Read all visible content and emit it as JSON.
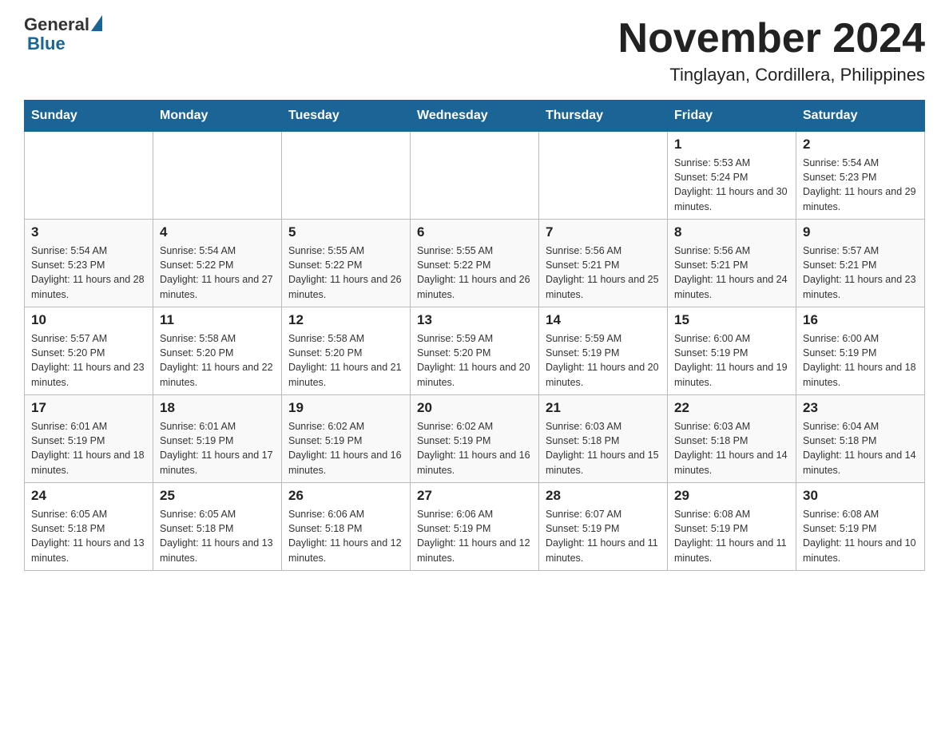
{
  "logo": {
    "general": "General",
    "blue": "Blue"
  },
  "title": "November 2024",
  "subtitle": "Tinglayan, Cordillera, Philippines",
  "days_of_week": [
    "Sunday",
    "Monday",
    "Tuesday",
    "Wednesday",
    "Thursday",
    "Friday",
    "Saturday"
  ],
  "weeks": [
    [
      {
        "day": "",
        "info": ""
      },
      {
        "day": "",
        "info": ""
      },
      {
        "day": "",
        "info": ""
      },
      {
        "day": "",
        "info": ""
      },
      {
        "day": "",
        "info": ""
      },
      {
        "day": "1",
        "info": "Sunrise: 5:53 AM\nSunset: 5:24 PM\nDaylight: 11 hours and 30 minutes."
      },
      {
        "day": "2",
        "info": "Sunrise: 5:54 AM\nSunset: 5:23 PM\nDaylight: 11 hours and 29 minutes."
      }
    ],
    [
      {
        "day": "3",
        "info": "Sunrise: 5:54 AM\nSunset: 5:23 PM\nDaylight: 11 hours and 28 minutes."
      },
      {
        "day": "4",
        "info": "Sunrise: 5:54 AM\nSunset: 5:22 PM\nDaylight: 11 hours and 27 minutes."
      },
      {
        "day": "5",
        "info": "Sunrise: 5:55 AM\nSunset: 5:22 PM\nDaylight: 11 hours and 26 minutes."
      },
      {
        "day": "6",
        "info": "Sunrise: 5:55 AM\nSunset: 5:22 PM\nDaylight: 11 hours and 26 minutes."
      },
      {
        "day": "7",
        "info": "Sunrise: 5:56 AM\nSunset: 5:21 PM\nDaylight: 11 hours and 25 minutes."
      },
      {
        "day": "8",
        "info": "Sunrise: 5:56 AM\nSunset: 5:21 PM\nDaylight: 11 hours and 24 minutes."
      },
      {
        "day": "9",
        "info": "Sunrise: 5:57 AM\nSunset: 5:21 PM\nDaylight: 11 hours and 23 minutes."
      }
    ],
    [
      {
        "day": "10",
        "info": "Sunrise: 5:57 AM\nSunset: 5:20 PM\nDaylight: 11 hours and 23 minutes."
      },
      {
        "day": "11",
        "info": "Sunrise: 5:58 AM\nSunset: 5:20 PM\nDaylight: 11 hours and 22 minutes."
      },
      {
        "day": "12",
        "info": "Sunrise: 5:58 AM\nSunset: 5:20 PM\nDaylight: 11 hours and 21 minutes."
      },
      {
        "day": "13",
        "info": "Sunrise: 5:59 AM\nSunset: 5:20 PM\nDaylight: 11 hours and 20 minutes."
      },
      {
        "day": "14",
        "info": "Sunrise: 5:59 AM\nSunset: 5:19 PM\nDaylight: 11 hours and 20 minutes."
      },
      {
        "day": "15",
        "info": "Sunrise: 6:00 AM\nSunset: 5:19 PM\nDaylight: 11 hours and 19 minutes."
      },
      {
        "day": "16",
        "info": "Sunrise: 6:00 AM\nSunset: 5:19 PM\nDaylight: 11 hours and 18 minutes."
      }
    ],
    [
      {
        "day": "17",
        "info": "Sunrise: 6:01 AM\nSunset: 5:19 PM\nDaylight: 11 hours and 18 minutes."
      },
      {
        "day": "18",
        "info": "Sunrise: 6:01 AM\nSunset: 5:19 PM\nDaylight: 11 hours and 17 minutes."
      },
      {
        "day": "19",
        "info": "Sunrise: 6:02 AM\nSunset: 5:19 PM\nDaylight: 11 hours and 16 minutes."
      },
      {
        "day": "20",
        "info": "Sunrise: 6:02 AM\nSunset: 5:19 PM\nDaylight: 11 hours and 16 minutes."
      },
      {
        "day": "21",
        "info": "Sunrise: 6:03 AM\nSunset: 5:18 PM\nDaylight: 11 hours and 15 minutes."
      },
      {
        "day": "22",
        "info": "Sunrise: 6:03 AM\nSunset: 5:18 PM\nDaylight: 11 hours and 14 minutes."
      },
      {
        "day": "23",
        "info": "Sunrise: 6:04 AM\nSunset: 5:18 PM\nDaylight: 11 hours and 14 minutes."
      }
    ],
    [
      {
        "day": "24",
        "info": "Sunrise: 6:05 AM\nSunset: 5:18 PM\nDaylight: 11 hours and 13 minutes."
      },
      {
        "day": "25",
        "info": "Sunrise: 6:05 AM\nSunset: 5:18 PM\nDaylight: 11 hours and 13 minutes."
      },
      {
        "day": "26",
        "info": "Sunrise: 6:06 AM\nSunset: 5:18 PM\nDaylight: 11 hours and 12 minutes."
      },
      {
        "day": "27",
        "info": "Sunrise: 6:06 AM\nSunset: 5:19 PM\nDaylight: 11 hours and 12 minutes."
      },
      {
        "day": "28",
        "info": "Sunrise: 6:07 AM\nSunset: 5:19 PM\nDaylight: 11 hours and 11 minutes."
      },
      {
        "day": "29",
        "info": "Sunrise: 6:08 AM\nSunset: 5:19 PM\nDaylight: 11 hours and 11 minutes."
      },
      {
        "day": "30",
        "info": "Sunrise: 6:08 AM\nSunset: 5:19 PM\nDaylight: 11 hours and 10 minutes."
      }
    ]
  ]
}
